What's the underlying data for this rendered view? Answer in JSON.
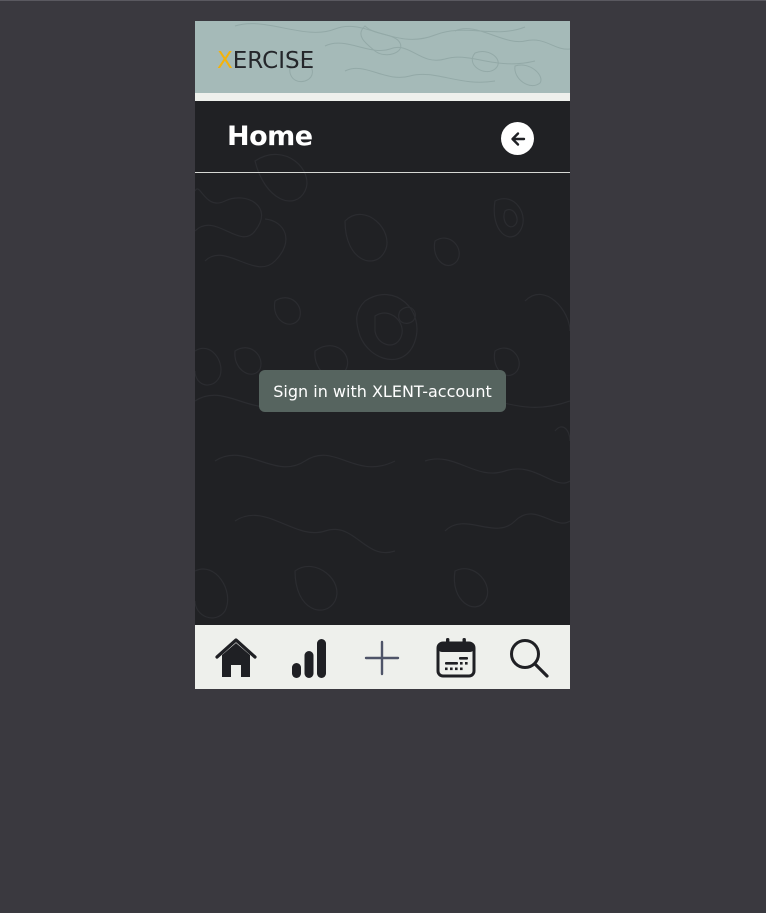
{
  "app": {
    "logo_accent": "X",
    "logo_rest": "ERCISE"
  },
  "header": {
    "title": "Home",
    "back_icon": "arrow-left-circle-icon"
  },
  "main": {
    "signin_label": "Sign in with XLENT-account"
  },
  "bottom_nav": {
    "items": [
      {
        "icon": "home-icon"
      },
      {
        "icon": "bar-chart-icon"
      },
      {
        "icon": "plus-icon"
      },
      {
        "icon": "calendar-icon"
      },
      {
        "icon": "search-icon"
      }
    ]
  },
  "colors": {
    "background": "#3a393f",
    "topbar": "#a5bab8",
    "accent": "#f5b30a",
    "main": "#202124",
    "button": "#56645f",
    "nav": "#eef0ec"
  }
}
